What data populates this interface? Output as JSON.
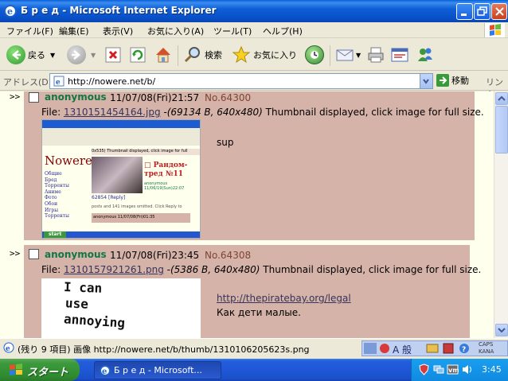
{
  "window": {
    "title": "Б р е д - Microsoft Internet Explorer"
  },
  "menu": {
    "items": [
      "ファイル(F)",
      "編集(E)",
      "表示(V)",
      "お気に入り(A)",
      "ツール(T)",
      "ヘルプ(H)"
    ]
  },
  "toolbar": {
    "back_label": "戻る",
    "search_label": "検索",
    "favorites_label": "お気に入り"
  },
  "address": {
    "label": "アドレス(D)",
    "url": "http://nowere.net/b/",
    "go_label": "移動",
    "links_label": "リンク"
  },
  "posts": [
    {
      "arrows": ">>",
      "poster": "anonymous",
      "date": "11/07/08(Fri)21:57",
      "number": "No.64300",
      "file_prefix": "File: ",
      "file_name": "1310151454164.jpg",
      "file_info": " -(69134 B, 640x480)",
      "file_suffix": " Thumbnail displayed, click image for full size.",
      "message": "sup"
    },
    {
      "arrows": ">>",
      "poster": "anonymous",
      "date": "11/07/08(Fri)23:45",
      "number": "No.64308",
      "file_prefix": "File: ",
      "file_name": "1310157921261.png",
      "file_info": " -(5386 B, 640x480)",
      "file_suffix": " Thumbnail displayed, click image for full size.",
      "link": "http://thepiratebay.org/legal",
      "message": "Как дети малые."
    }
  ],
  "thumb1": {
    "site_title": "Nowere",
    "nav": [
      "Общие",
      "Бред",
      "Торренты",
      "Аниме",
      "Фото",
      "Обои",
      "Игры",
      "Торренты"
    ],
    "thread_title": "□ Рандом-тред №11",
    "thread_meta": "anonymous 11/06/19(Sun)22:07",
    "reply_meta": "62854 [Reply]",
    "omitted": "posts and 141 images omitted. Click Reply to",
    "reply_line": "anonymous 11/07/08(Fri)01:35",
    "thumb_caption": "0x535) Thumbnail displayed, click image for full",
    "start": "start"
  },
  "thumb2": {
    "lines": [
      "I can",
      "use",
      "annoying"
    ]
  },
  "status": {
    "text": "(残り 9 項目) 画像 http://nowere.net/b/thumb/1310106205623s.png"
  },
  "langbar": {
    "mode": "A 般",
    "caps": "CAPS",
    "kana": "KANA"
  },
  "taskbar": {
    "start_label": "スタート",
    "task_label": "Б р е д - Microsoft...",
    "clock": "3:45"
  }
}
